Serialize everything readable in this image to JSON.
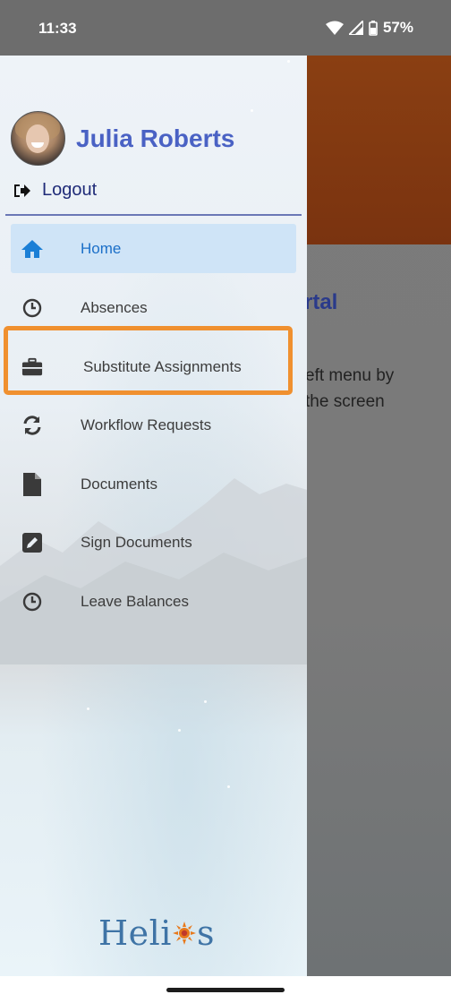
{
  "status": {
    "time": "11:33",
    "battery": "57%"
  },
  "background_app": {
    "portal_title_partial": "rtal",
    "hint_line1": "eft menu by",
    "hint_line2": " the screen"
  },
  "drawer": {
    "user_name": "Julia Roberts",
    "logout_label": "Logout",
    "items": [
      {
        "label": "Home",
        "icon": "home-icon",
        "active": true
      },
      {
        "label": "Absences",
        "icon": "clock-icon"
      },
      {
        "label": "Substitute Assignments",
        "icon": "briefcase-icon"
      },
      {
        "label": "Workflow Requests",
        "icon": "refresh-icon"
      },
      {
        "label": "Documents",
        "icon": "document-icon"
      },
      {
        "label": "Sign Documents",
        "icon": "edit-icon"
      },
      {
        "label": "Leave Balances",
        "icon": "clock-icon"
      }
    ],
    "logo_left": "Heli",
    "logo_right": "s"
  },
  "colors": {
    "accent": "#4a62c4",
    "active_item_bg": "#cfe4f7",
    "highlight": "#f0902f",
    "logo": "#3f74a6"
  }
}
